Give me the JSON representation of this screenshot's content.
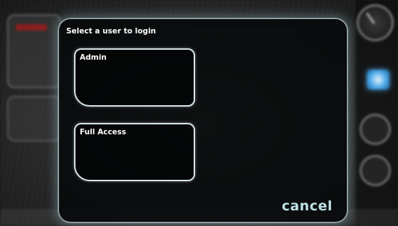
{
  "dialog": {
    "title": "Select a user to login",
    "users": [
      {
        "label": "Admin"
      },
      {
        "label": "Full Access"
      }
    ],
    "cancel_label": "cancel"
  },
  "colors": {
    "dialog_border": "#b9cdd2",
    "tile_border": "#d8e6e9",
    "cancel_text": "#bfe0e6",
    "accent_blue": "#4aa6e6"
  },
  "icons": {
    "right_rail": [
      "gauge-icon",
      "home-icon",
      "round-button-icon",
      "round-button-icon"
    ]
  }
}
